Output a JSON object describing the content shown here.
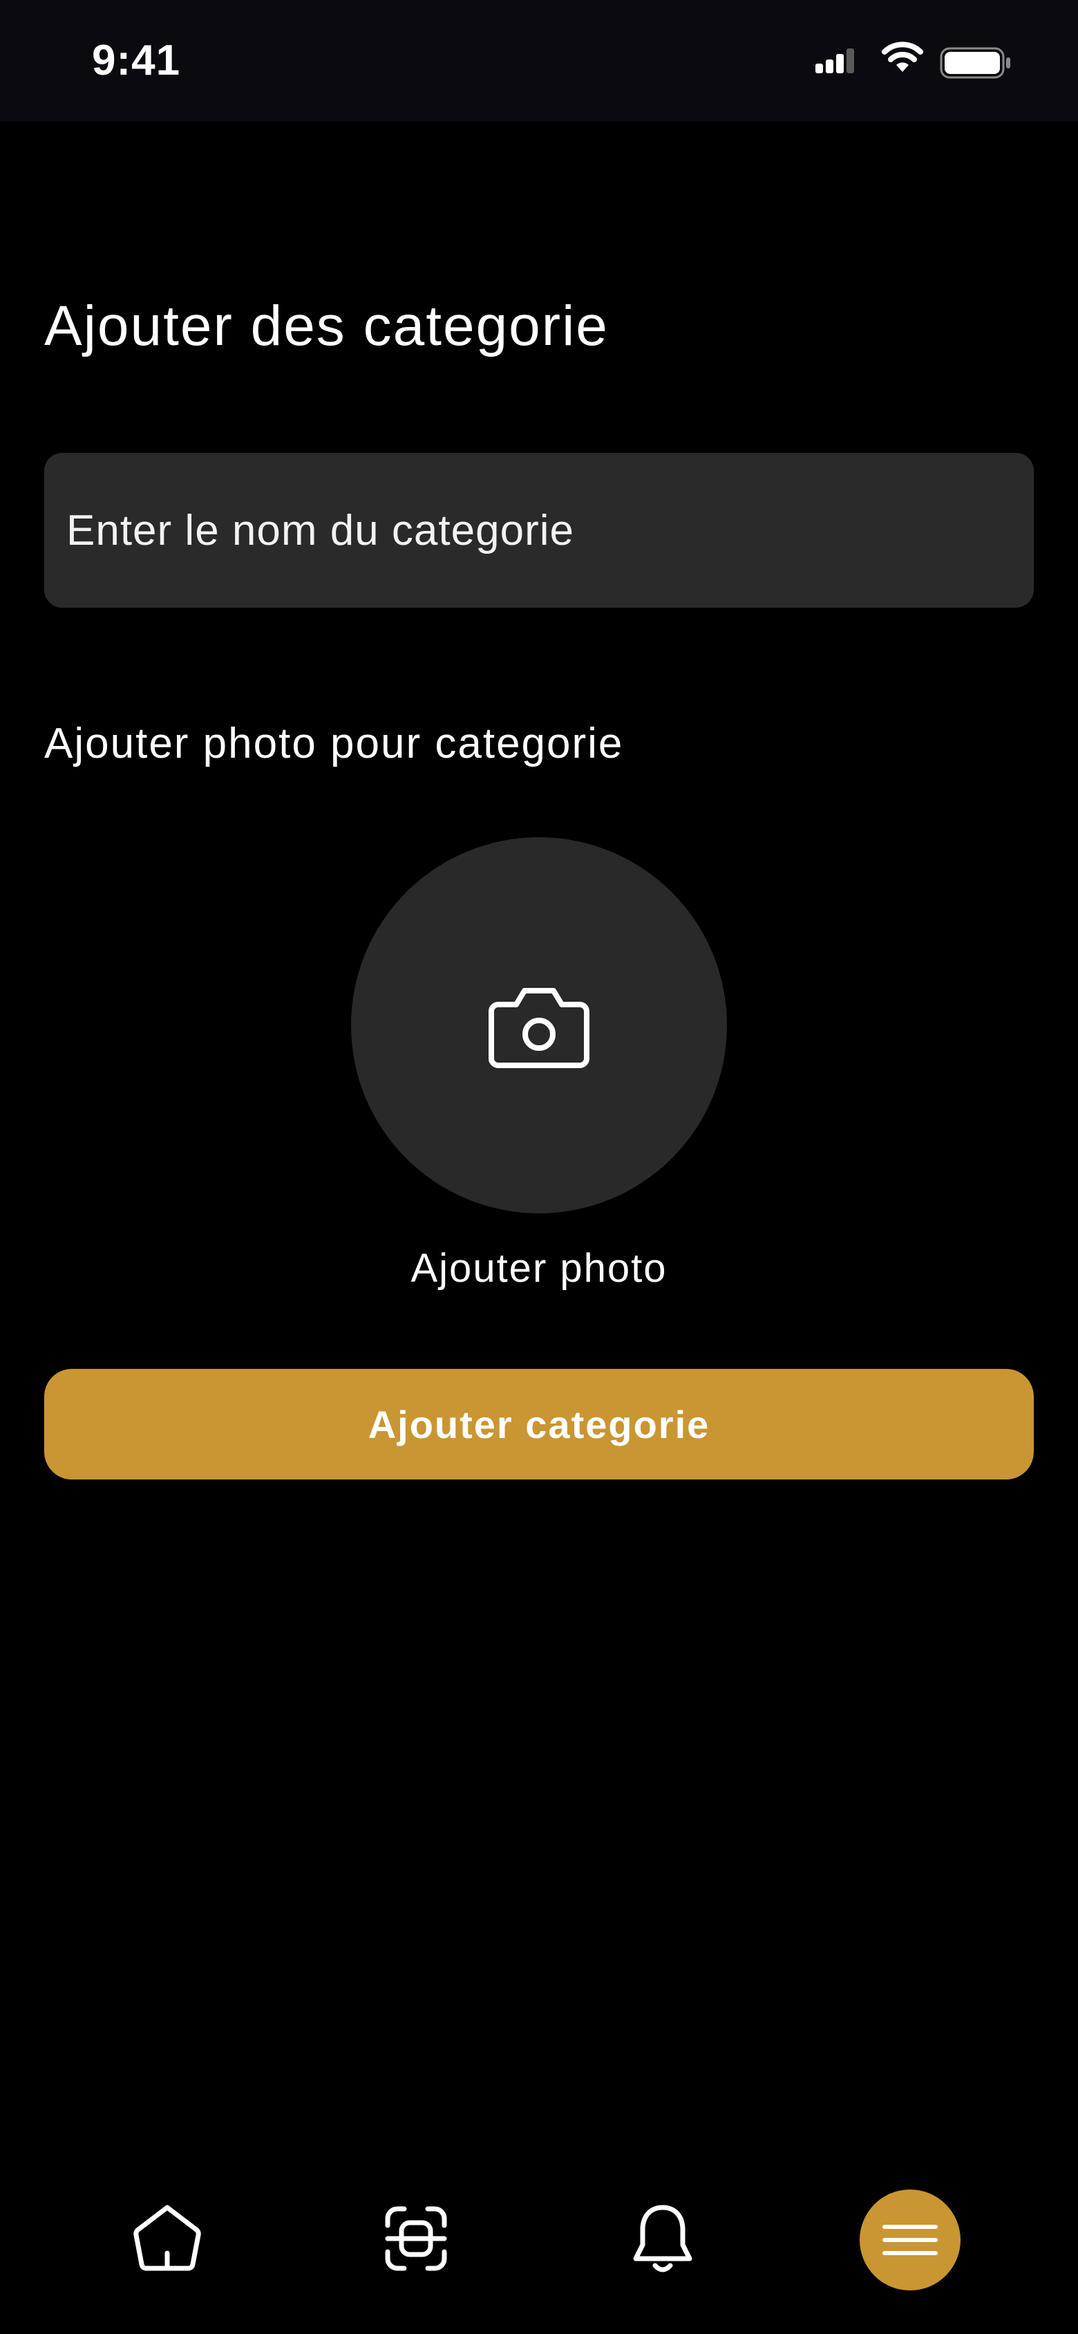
{
  "status_bar": {
    "time": "9:41",
    "icons": [
      "signal-icon",
      "wifi-icon",
      "battery-icon"
    ]
  },
  "page": {
    "title": "Ajouter des categorie"
  },
  "form": {
    "name_placeholder": "Enter le nom du categorie",
    "name_value": "",
    "photo_section_label": "Ajouter photo pour categorie",
    "photo_caption": "Ajouter photo",
    "submit_label": "Ajouter categorie"
  },
  "bottom_nav": {
    "items": [
      {
        "icon": "home-icon"
      },
      {
        "icon": "scan-icon"
      },
      {
        "icon": "bell-icon"
      },
      {
        "icon": "menu-icon",
        "active": true
      }
    ]
  },
  "colors": {
    "background": "#000000",
    "input_background": "#2a2a2a",
    "accent": "#c99632",
    "text": "#ffffff"
  }
}
